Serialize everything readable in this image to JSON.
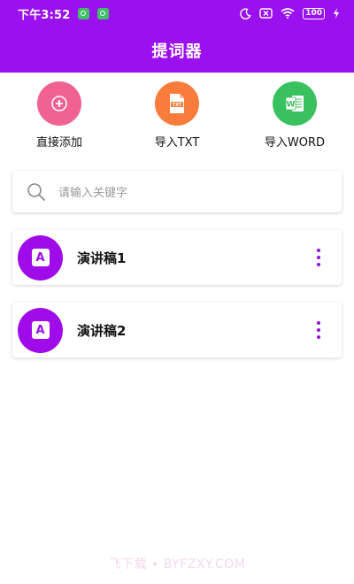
{
  "status_bar": {
    "time": "下午3:52",
    "battery": "100",
    "icons": [
      "moon-icon",
      "sim-off-icon",
      "wifi-icon",
      "charging-icon"
    ]
  },
  "header": {
    "title": "提词器",
    "background": "#9a10ee"
  },
  "actions": [
    {
      "label": "直接添加",
      "icon": "plus-icon",
      "color": "#f06292"
    },
    {
      "label": "导入TXT",
      "icon": "txt-file-icon",
      "color": "#f97c3c"
    },
    {
      "label": "导入WORD",
      "icon": "word-icon",
      "color": "#39c15f"
    }
  ],
  "search": {
    "placeholder": "请输入关键字"
  },
  "scripts": [
    {
      "name": "演讲稿1",
      "icon": "document-a-icon"
    },
    {
      "name": "演讲稿2",
      "icon": "document-a-icon"
    }
  ],
  "watermark": "飞下载 • BYFZXY.COM"
}
